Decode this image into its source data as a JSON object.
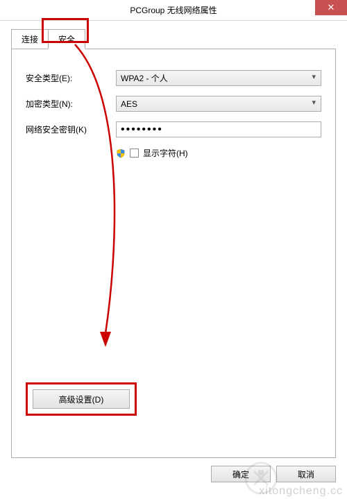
{
  "window": {
    "title": "PCGroup 无线网络属性",
    "close": "✕"
  },
  "tabs": {
    "connect": "连接",
    "security": "安全"
  },
  "form": {
    "security_type_label": "安全类型(E):",
    "security_type_value": "WPA2 - 个人",
    "encryption_label": "加密类型(N):",
    "encryption_value": "AES",
    "key_label": "网络安全密钥(K)",
    "key_value": "••••••••",
    "show_chars_label": "显示字符(H)"
  },
  "buttons": {
    "advanced": "高级设置(D)",
    "ok": "确定",
    "cancel": "取消"
  },
  "watermark": "xitongcheng.cc"
}
